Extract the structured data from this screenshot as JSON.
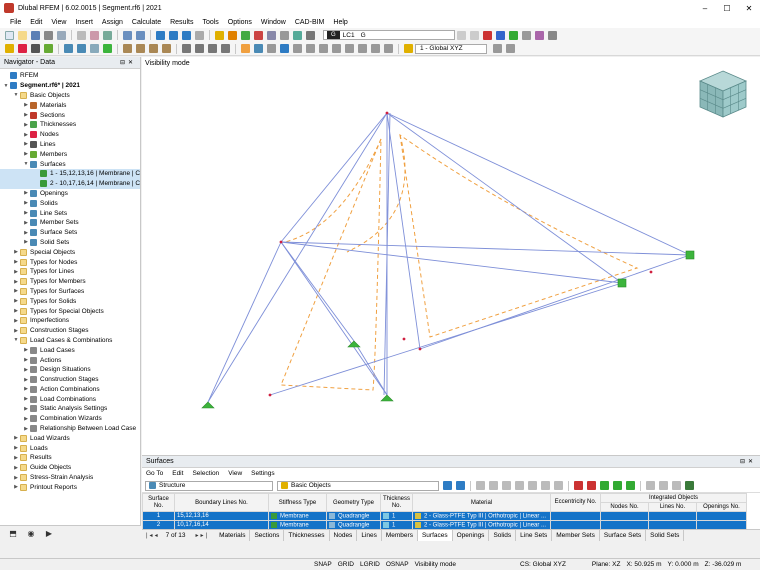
{
  "app": {
    "title": "Dlubal RFEM | 6.02.0015 | Segment.rf6 | 2021"
  },
  "menu": [
    "File",
    "Edit",
    "View",
    "Insert",
    "Assign",
    "Calculate",
    "Results",
    "Tools",
    "Options",
    "Window",
    "CAD-BIM",
    "Help"
  ],
  "toolbar": {
    "load_case_tag": "G",
    "load_case_id": "LC1",
    "load_case_name": "G",
    "view_select": "1 - Global XYZ"
  },
  "navigator": {
    "title": "Navigator - Data",
    "items": [
      {
        "label": "RFEM",
        "level": 0,
        "icon": "rfem-icon",
        "color": "#2e7cc4",
        "sel": false
      },
      {
        "label": "Segment.rf6* | 2021",
        "level": 0,
        "icon": "model-icon",
        "color": "#2e7cc4",
        "sel": false
      },
      {
        "label": "Basic Objects",
        "level": 1,
        "icon": "folder-icon",
        "color": "",
        "sel": false
      },
      {
        "label": "Materials",
        "level": 2,
        "icon": "materials-icon",
        "color": "#b8652b",
        "sel": false
      },
      {
        "label": "Sections",
        "level": 2,
        "icon": "sections-icon",
        "color": "#c0392b",
        "sel": false
      },
      {
        "label": "Thicknesses",
        "level": 2,
        "icon": "thickness-icon",
        "color": "#4aa34a",
        "sel": false
      },
      {
        "label": "Nodes",
        "level": 2,
        "icon": "nodes-icon",
        "color": "#d24",
        "sel": false
      },
      {
        "label": "Lines",
        "level": 2,
        "icon": "lines-icon",
        "color": "#555",
        "sel": false
      },
      {
        "label": "Members",
        "level": 2,
        "icon": "members-icon",
        "color": "#6a3",
        "sel": false
      },
      {
        "label": "Surfaces",
        "level": 2,
        "icon": "surfaces-icon",
        "color": "#4a8ab5",
        "sel": false
      },
      {
        "label": "1 - 15,12,13,16 | Membrane | C",
        "level": 3,
        "icon": "surface-item-icon",
        "color": "#3a9a3a",
        "sel": true
      },
      {
        "label": "2 - 10,17,16,14 | Membrane | C",
        "level": 3,
        "icon": "surface-item-icon",
        "color": "#3a9a3a",
        "sel": true
      },
      {
        "label": "Openings",
        "level": 2,
        "icon": "openings-icon",
        "color": "#4a8ab5",
        "sel": false
      },
      {
        "label": "Solids",
        "level": 2,
        "icon": "solids-icon",
        "color": "#4a8ab5",
        "sel": false
      },
      {
        "label": "Line Sets",
        "level": 2,
        "icon": "line-sets-icon",
        "color": "#4a8ab5",
        "sel": false
      },
      {
        "label": "Member Sets",
        "level": 2,
        "icon": "member-sets-icon",
        "color": "#4a8ab5",
        "sel": false
      },
      {
        "label": "Surface Sets",
        "level": 2,
        "icon": "surface-sets-icon",
        "color": "#4a8ab5",
        "sel": false
      },
      {
        "label": "Solid Sets",
        "level": 2,
        "icon": "solid-sets-icon",
        "color": "#4a8ab5",
        "sel": false
      },
      {
        "label": "Special Objects",
        "level": 1,
        "icon": "folder-icon",
        "color": "",
        "sel": false
      },
      {
        "label": "Types for Nodes",
        "level": 1,
        "icon": "folder-icon",
        "color": "",
        "sel": false
      },
      {
        "label": "Types for Lines",
        "level": 1,
        "icon": "folder-icon",
        "color": "",
        "sel": false
      },
      {
        "label": "Types for Members",
        "level": 1,
        "icon": "folder-icon",
        "color": "",
        "sel": false
      },
      {
        "label": "Types for Surfaces",
        "level": 1,
        "icon": "folder-icon",
        "color": "",
        "sel": false
      },
      {
        "label": "Types for Solids",
        "level": 1,
        "icon": "folder-icon",
        "color": "",
        "sel": false
      },
      {
        "label": "Types for Special Objects",
        "level": 1,
        "icon": "folder-icon",
        "color": "",
        "sel": false
      },
      {
        "label": "Imperfections",
        "level": 1,
        "icon": "folder-icon",
        "color": "",
        "sel": false
      },
      {
        "label": "Construction Stages",
        "level": 1,
        "icon": "folder-icon",
        "color": "",
        "sel": false
      },
      {
        "label": "Load Cases & Combinations",
        "level": 1,
        "icon": "folder-icon",
        "color": "",
        "sel": false
      },
      {
        "label": "Load Cases",
        "level": 2,
        "icon": "load-cases-icon",
        "color": "#888",
        "sel": false
      },
      {
        "label": "Actions",
        "level": 2,
        "icon": "actions-icon",
        "color": "#888",
        "sel": false
      },
      {
        "label": "Design Situations",
        "level": 2,
        "icon": "design-situations-icon",
        "color": "#888",
        "sel": false
      },
      {
        "label": "Construction Stages",
        "level": 2,
        "icon": "construction-stages-icon",
        "color": "#888",
        "sel": false
      },
      {
        "label": "Action Combinations",
        "level": 2,
        "icon": "action-combinations-icon",
        "color": "#888",
        "sel": false
      },
      {
        "label": "Load Combinations",
        "level": 2,
        "icon": "load-combinations-icon",
        "color": "#888",
        "sel": false
      },
      {
        "label": "Static Analysis Settings",
        "level": 2,
        "icon": "analysis-settings-icon",
        "color": "#888",
        "sel": false
      },
      {
        "label": "Combination Wizards",
        "level": 2,
        "icon": "combination-wizards-icon",
        "color": "#888",
        "sel": false
      },
      {
        "label": "Relationship Between Load Case",
        "level": 2,
        "icon": "relationship-icon",
        "color": "#888",
        "sel": false
      },
      {
        "label": "Load Wizards",
        "level": 1,
        "icon": "folder-icon",
        "color": "",
        "sel": false
      },
      {
        "label": "Loads",
        "level": 1,
        "icon": "folder-icon",
        "color": "",
        "sel": false
      },
      {
        "label": "Results",
        "level": 1,
        "icon": "folder-icon",
        "color": "",
        "sel": false
      },
      {
        "label": "Guide Objects",
        "level": 1,
        "icon": "folder-icon",
        "color": "",
        "sel": false
      },
      {
        "label": "Stress-Strain Analysis",
        "level": 1,
        "icon": "folder-icon",
        "color": "",
        "sel": false
      },
      {
        "label": "Printout Reports",
        "level": 1,
        "icon": "folder-icon",
        "color": "",
        "sel": false
      }
    ]
  },
  "view": {
    "label": "Visibility mode"
  },
  "panel": {
    "title": "Surfaces",
    "menu": [
      "Go To",
      "Edit",
      "Selection",
      "View",
      "Settings"
    ],
    "filter_left": "Structure",
    "filter_right": "Basic Objects",
    "group_header": "Integrated Objects",
    "columns": [
      "Surface No.",
      "Boundary Lines No.",
      "Stiffness Type",
      "Geometry Type",
      "Thickness No.",
      "Material",
      "Eccentricity No.",
      "Nodes No.",
      "Lines No.",
      "Openings No."
    ],
    "rows": [
      {
        "no": "1",
        "lines": "15,12,13,16",
        "stiffness": "Membrane",
        "geometry": "Quadrangle",
        "thickness": "1",
        "material": "2 - Glass-PTFE Typ III | Orthotropic | Linear ...",
        "ecc": "",
        "nodes": "",
        "ilines": "",
        "openings": ""
      },
      {
        "no": "2",
        "lines": "10,17,16,14",
        "stiffness": "Membrane",
        "geometry": "Quadrangle",
        "thickness": "1",
        "material": "2 - Glass-PTFE Typ III | Orthotropic | Linear ...",
        "ecc": "",
        "nodes": "",
        "ilines": "",
        "openings": ""
      }
    ],
    "page": "7 of 13",
    "tabs": [
      "Materials",
      "Sections",
      "Thicknesses",
      "Nodes",
      "Lines",
      "Members",
      "Surfaces",
      "Openings",
      "Solids",
      "Line Sets",
      "Member Sets",
      "Surface Sets",
      "Solid Sets"
    ],
    "active_tab": "Surfaces"
  },
  "status": {
    "toggles": [
      "SNAP",
      "GRID",
      "LGRID",
      "OSNAP",
      "Visibility mode"
    ],
    "cs": "CS: Global XYZ",
    "plane": "Plane: XZ",
    "x": "X: 50.925 m",
    "y": "Y: 0.000 m",
    "z": "Z: -36.029 m"
  },
  "colors": {
    "accent": "#1473c8",
    "membrane_green": "#3a9a3a",
    "line_blue": "#7e8fd8",
    "cutting_orange": "#f0a040",
    "support_green": "#3cb43c"
  }
}
